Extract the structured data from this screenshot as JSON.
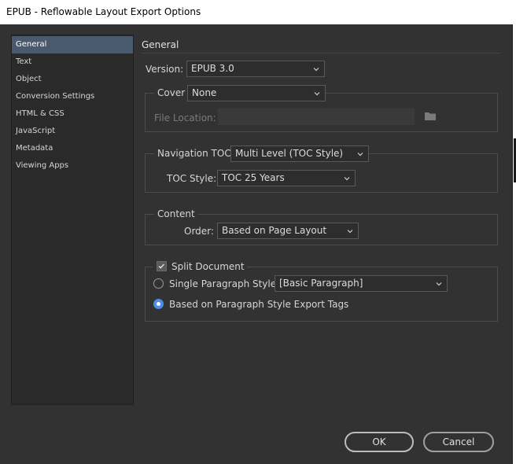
{
  "window": {
    "title": "EPUB - Reflowable Layout Export Options"
  },
  "sidebar": {
    "items": [
      {
        "label": "General",
        "active": true
      },
      {
        "label": "Text"
      },
      {
        "label": "Object"
      },
      {
        "label": "Conversion Settings"
      },
      {
        "label": "HTML & CSS"
      },
      {
        "label": "JavaScript"
      },
      {
        "label": "Metadata"
      },
      {
        "label": "Viewing Apps"
      }
    ]
  },
  "general": {
    "section_title": "General",
    "version": {
      "label": "Version:",
      "value": "EPUB 3.0"
    },
    "cover": {
      "label": "Cover",
      "value": "None",
      "file_location_label": "File Location:",
      "file_location_value": ""
    },
    "navigation": {
      "label": "Navigation TOC",
      "value": "Multi Level (TOC Style)",
      "toc_style_label": "TOC Style:",
      "toc_style_value": "TOC 25 Years"
    },
    "content": {
      "label": "Content",
      "order_label": "Order:",
      "order_value": "Based on Page Layout"
    },
    "split": {
      "label": "Split Document",
      "checked": true,
      "single_paragraph_label": "Single Paragraph Style",
      "single_paragraph_value": "[Basic Paragraph]",
      "export_tags_label": "Based on Paragraph Style Export Tags",
      "selected": "export_tags"
    }
  },
  "buttons": {
    "ok": "OK",
    "cancel": "Cancel"
  },
  "colors": {
    "accent": "#4a8ee8",
    "sidebar_active": "#4a5a6e",
    "background": "#323232"
  }
}
